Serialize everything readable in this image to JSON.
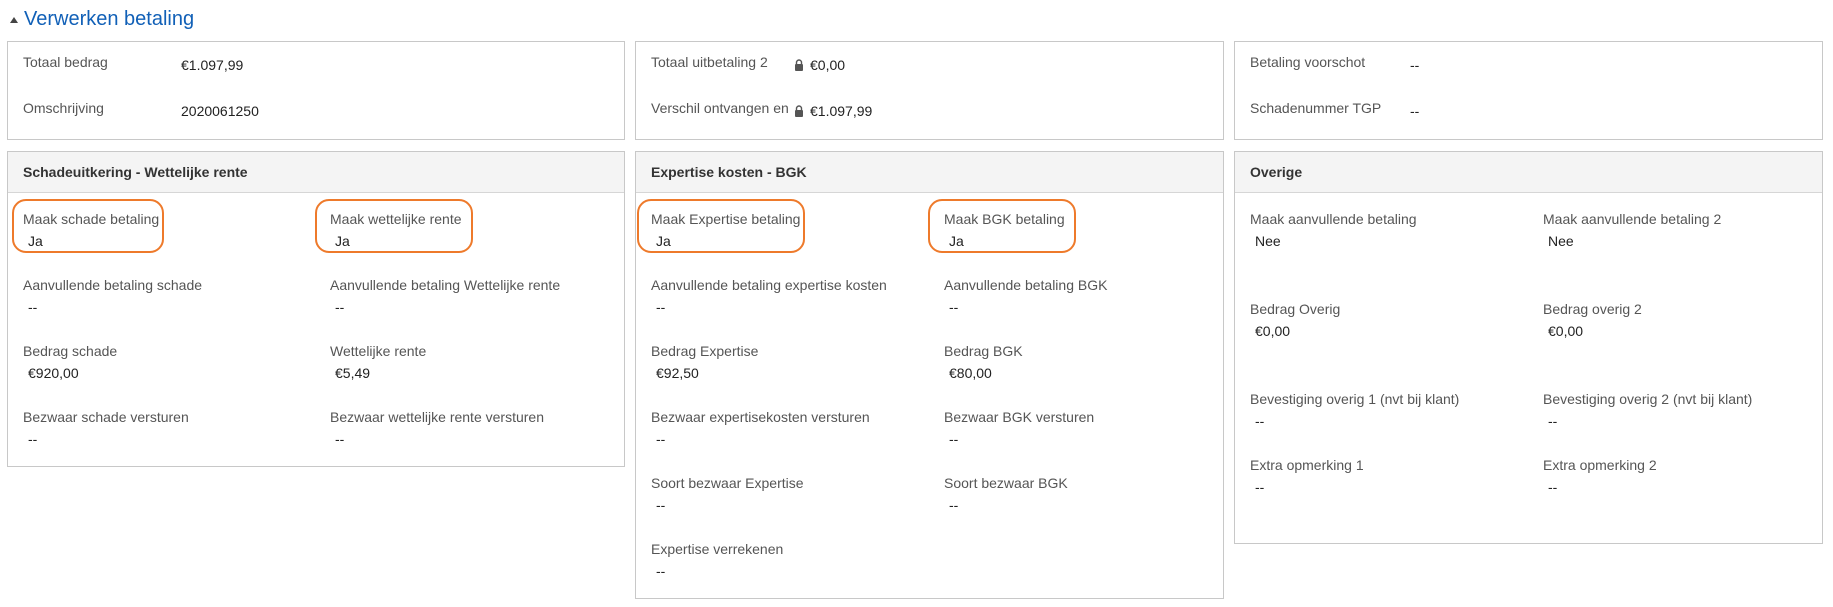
{
  "header": {
    "title": "Verwerken betaling"
  },
  "summary": {
    "totaal_bedrag": {
      "label": "Totaal bedrag",
      "value": "€1.097,99"
    },
    "omschrijving": {
      "label": "Omschrijving",
      "value": "2020061250"
    },
    "totaal_uitbetaling_2": {
      "label": "Totaal uitbetaling 2",
      "value": "€0,00"
    },
    "verschil_ontvangen": {
      "label": "Verschil ontvangen en",
      "value": "€1.097,99"
    },
    "betaling_voorschot": {
      "label": "Betaling voorschot",
      "value": "--"
    },
    "schadenummer_tgp": {
      "label": "Schadenummer TGP",
      "value": "--"
    }
  },
  "cards": {
    "schade": {
      "title": "Schadeuitkering - Wettelijke rente",
      "fields": [
        {
          "label": "Maak schade betaling",
          "value": "Ja"
        },
        {
          "label": "Maak wettelijke rente",
          "value": "Ja"
        },
        {
          "label": "Aanvullende betaling schade",
          "value": "--"
        },
        {
          "label": "Aanvullende betaling Wettelijke rente",
          "value": "--"
        },
        {
          "label": "Bedrag schade",
          "value": "€920,00"
        },
        {
          "label": "Wettelijke rente",
          "value": "€5,49"
        },
        {
          "label": "Bezwaar schade versturen",
          "value": "--"
        },
        {
          "label": "Bezwaar wettelijke rente versturen",
          "value": "--"
        }
      ]
    },
    "expertise": {
      "title": "Expertise kosten - BGK",
      "fields": [
        {
          "label": "Maak Expertise betaling",
          "value": "Ja"
        },
        {
          "label": "Maak BGK betaling",
          "value": "Ja"
        },
        {
          "label": "Aanvullende betaling expertise kosten",
          "value": "--"
        },
        {
          "label": "Aanvullende betaling BGK",
          "value": "--"
        },
        {
          "label": "Bedrag Expertise",
          "value": "€92,50"
        },
        {
          "label": "Bedrag BGK",
          "value": "€80,00"
        },
        {
          "label": "Bezwaar expertisekosten versturen",
          "value": "--"
        },
        {
          "label": "Bezwaar BGK versturen",
          "value": "--"
        },
        {
          "label": "Soort bezwaar Expertise",
          "value": "--"
        },
        {
          "label": "Soort bezwaar BGK",
          "value": "--"
        },
        {
          "label": "Expertise verrekenen",
          "value": "--"
        }
      ]
    },
    "overige": {
      "title": "Overige",
      "fields": [
        {
          "label": "Maak aanvullende betaling",
          "value": "Nee"
        },
        {
          "label": "Maak aanvullende betaling 2",
          "value": "Nee"
        },
        {
          "label": "Bedrag Overig",
          "value": "€0,00"
        },
        {
          "label": "Bedrag overig 2",
          "value": "€0,00"
        },
        {
          "label": "Bevestiging overig 1 (nvt bij klant)",
          "value": "--"
        },
        {
          "label": "Bevestiging overig 2 (nvt bij klant)",
          "value": "--"
        },
        {
          "label": "Extra opmerking 1",
          "value": "--"
        },
        {
          "label": "Extra opmerking 2",
          "value": "--"
        }
      ]
    }
  },
  "colors": {
    "accent": "#1160b7",
    "highlight": "#ee7a2b",
    "border": "#c8c8c8"
  }
}
